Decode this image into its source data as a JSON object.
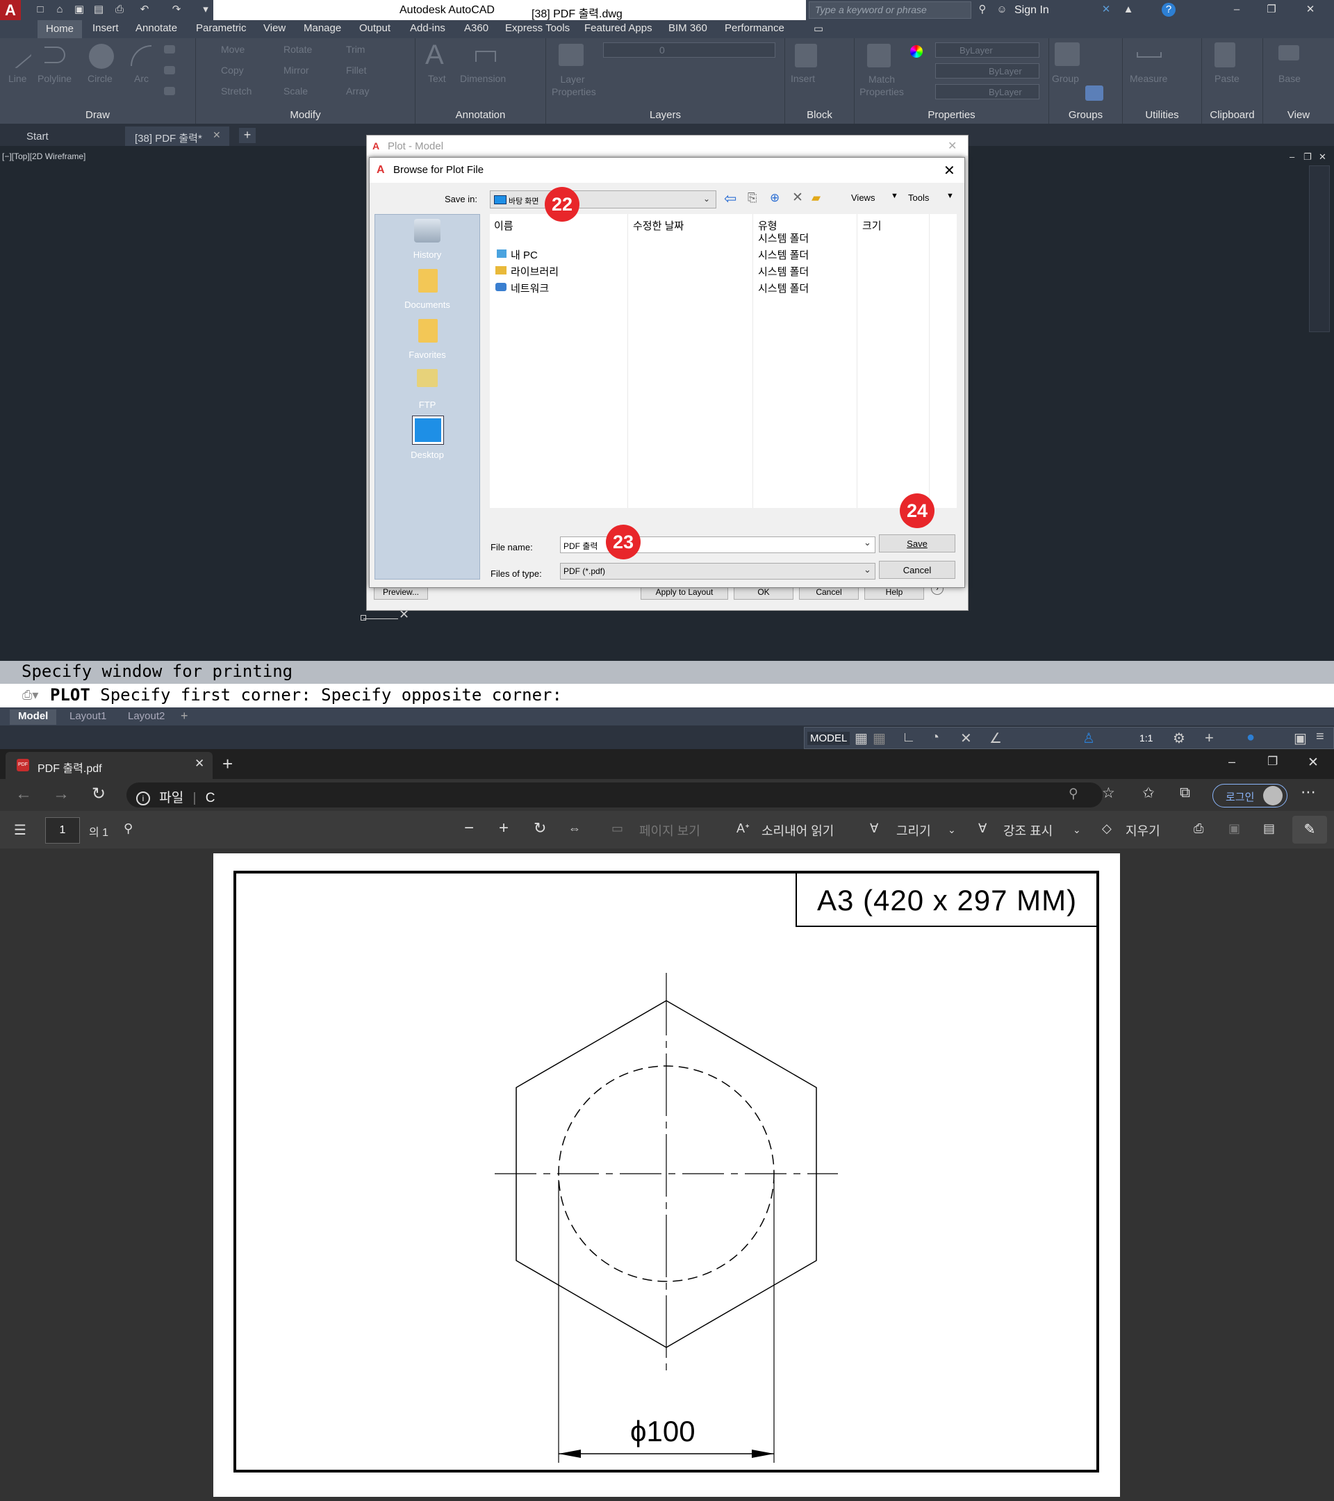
{
  "autocad": {
    "app_title": "Autodesk AutoCAD",
    "doc_title": "[38] PDF 출력.dwg",
    "search_placeholder": "Type a keyword or phrase",
    "sign_in": "Sign In",
    "menu_tabs": [
      "Home",
      "Insert",
      "Annotate",
      "Parametric",
      "View",
      "Manage",
      "Output",
      "Add-ins",
      "A360",
      "Express Tools",
      "Featured Apps",
      "BIM 360",
      "Performance"
    ],
    "ribbon": {
      "draw_tools": [
        "Line",
        "Polyline",
        "Circle",
        "Arc"
      ],
      "modify_tools": [
        "Move",
        "Rotate",
        "Trim",
        "Copy",
        "Mirror",
        "Fillet",
        "Stretch",
        "Scale",
        "Array"
      ],
      "annotation_tools": [
        "Text",
        "Dimension"
      ],
      "layer_tools": [
        "Layer Properties"
      ],
      "layer_value": "0",
      "block_tools": [
        "Insert"
      ],
      "match_tool": "Match Properties",
      "bylayer": "ByLayer",
      "group_tool": "Group",
      "measure_tool": "Measure",
      "paste_tool": "Paste",
      "base_tool": "Base",
      "panels": [
        "Draw",
        "Modify",
        "Annotation",
        "Layers",
        "Block",
        "Properties",
        "Groups",
        "Utilities",
        "Clipboard",
        "View"
      ]
    },
    "doc_tabs": [
      "Start",
      "[38] PDF 출력*"
    ],
    "viewport_label": "[−][Top][2D Wireframe]",
    "command_history": "Specify window for printing",
    "command_name": "PLOT",
    "command_prompt": "Specify first corner: Specify opposite corner:",
    "layout_tabs": [
      "Model",
      "Layout1",
      "Layout2"
    ],
    "status_model": "MODEL",
    "status_scale": "1:1"
  },
  "plot_dialog": {
    "title": "Plot - Model",
    "buttons": [
      "Preview...",
      "Apply to Layout",
      "OK",
      "Cancel",
      "Help"
    ]
  },
  "browse_dialog": {
    "title": "Browse for Plot File",
    "save_in_label": "Save in:",
    "save_in_value": "바탕 화면",
    "views": "Views",
    "tools": "Tools",
    "places": [
      "History",
      "Documents",
      "Favorites",
      "FTP",
      "Desktop"
    ],
    "columns": [
      "이름",
      "수정한 날짜",
      "유형",
      "크기"
    ],
    "files": [
      {
        "name": "",
        "type": "시스템 폴더"
      },
      {
        "name": "내 PC",
        "type": "시스템 폴더"
      },
      {
        "name": "라이브러리",
        "type": "시스템 폴더"
      },
      {
        "name": "네트워크",
        "type": "시스템 폴더"
      }
    ],
    "file_name_label": "File name:",
    "file_name_value": "PDF 출력",
    "file_type_label": "Files of type:",
    "file_type_value": "PDF (*.pdf)",
    "save_button": "Save",
    "cancel_button": "Cancel"
  },
  "badges": [
    "22",
    "23",
    "24"
  ],
  "edge": {
    "tab_title": "PDF 출력.pdf",
    "url_prefix": "파일",
    "url_text": "C",
    "login": "로그인",
    "page_number": "1",
    "page_total": "의 1",
    "page_view": "페이지 보기",
    "read_aloud": "소리내어 읽기",
    "draw": "그리기",
    "highlight": "강조 표시",
    "erase": "지우기"
  },
  "pdf": {
    "title_block": "A3 (420 x 297 MM)",
    "dimension": "ϕ100"
  },
  "colors": {
    "badge": "#e8262a",
    "autocad_bg": "#212830",
    "ribbon": "#434b59"
  }
}
